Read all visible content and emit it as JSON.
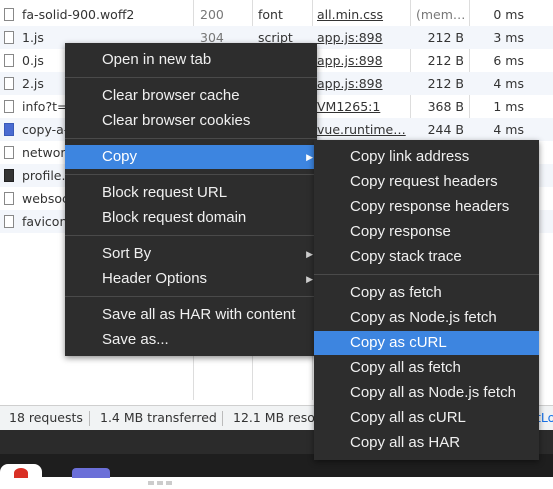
{
  "network": {
    "rows": [
      {
        "name": "fa-solid-900.woff2",
        "status": "200",
        "type": "font",
        "initiator": "all.min.css",
        "size": "(mem…",
        "time": "0 ms",
        "icon": "file-icon"
      },
      {
        "name": "1.js",
        "status": "304",
        "type": "script",
        "initiator": "app.js:898",
        "size": "212 B",
        "time": "3 ms",
        "icon": "file-icon"
      },
      {
        "name": "0.js",
        "status": "",
        "type": "",
        "initiator": "app.js:898",
        "size": "212 B",
        "time": "6 ms",
        "icon": "file-icon"
      },
      {
        "name": "2.js",
        "status": "",
        "type": "",
        "initiator": "app.js:898",
        "size": "212 B",
        "time": "4 ms",
        "icon": "file-icon"
      },
      {
        "name": "info?t=",
        "status": "",
        "type": "",
        "initiator": "VM1265:1",
        "size": "368 B",
        "time": "1 ms",
        "icon": "file-icon"
      },
      {
        "name": "copy-a-",
        "status": "",
        "type": "",
        "initiator": "vue.runtime…",
        "size": "244 B",
        "time": "4 ms",
        "icon": "image-icon"
      },
      {
        "name": "networ",
        "status": "",
        "type": "",
        "initiator": "",
        "size": "",
        "time": "",
        "icon": "file-icon"
      },
      {
        "name": "profile.",
        "status": "",
        "type": "",
        "initiator": "",
        "size": "",
        "time": "",
        "icon": "image-icon-dark"
      },
      {
        "name": "websoc",
        "status": "",
        "type": "",
        "initiator": "",
        "size": "",
        "time": "",
        "icon": "file-icon"
      },
      {
        "name": "favicon",
        "status": "",
        "type": "",
        "initiator": "",
        "size": "",
        "time": "",
        "icon": "file-icon"
      }
    ]
  },
  "statusbar": {
    "requests": "18 requests",
    "transferred": "1.4 MB transferred",
    "resources": "12.1 MB resou",
    "link_fragment": "tLo"
  },
  "context_menu": {
    "items": [
      {
        "label": "Open in new tab"
      },
      {
        "label": "Clear browser cache"
      },
      {
        "label": "Clear browser cookies"
      },
      {
        "label": "Copy",
        "submenu": true,
        "selected": true
      },
      {
        "label": "Block request URL"
      },
      {
        "label": "Block request domain"
      },
      {
        "label": "Sort By",
        "submenu": true
      },
      {
        "label": "Header Options",
        "submenu": true
      },
      {
        "label": "Save all as HAR with content"
      },
      {
        "label": "Save as..."
      }
    ]
  },
  "copy_submenu": {
    "items": [
      {
        "label": "Copy link address"
      },
      {
        "label": "Copy request headers"
      },
      {
        "label": "Copy response headers"
      },
      {
        "label": "Copy response"
      },
      {
        "label": "Copy stack trace"
      },
      {
        "label": "Copy as fetch"
      },
      {
        "label": "Copy as Node.js fetch"
      },
      {
        "label": "Copy as cURL",
        "selected": true
      },
      {
        "label": "Copy all as fetch"
      },
      {
        "label": "Copy all as Node.js fetch"
      },
      {
        "label": "Copy all as cURL"
      },
      {
        "label": "Copy all as HAR"
      }
    ]
  },
  "icons": {
    "submenu_arrow": "submenu-arrow-icon"
  },
  "colors": {
    "menu_bg": "#2d2d2d",
    "highlight": "#3d85e0",
    "row_alt": "#f3f6fb"
  }
}
